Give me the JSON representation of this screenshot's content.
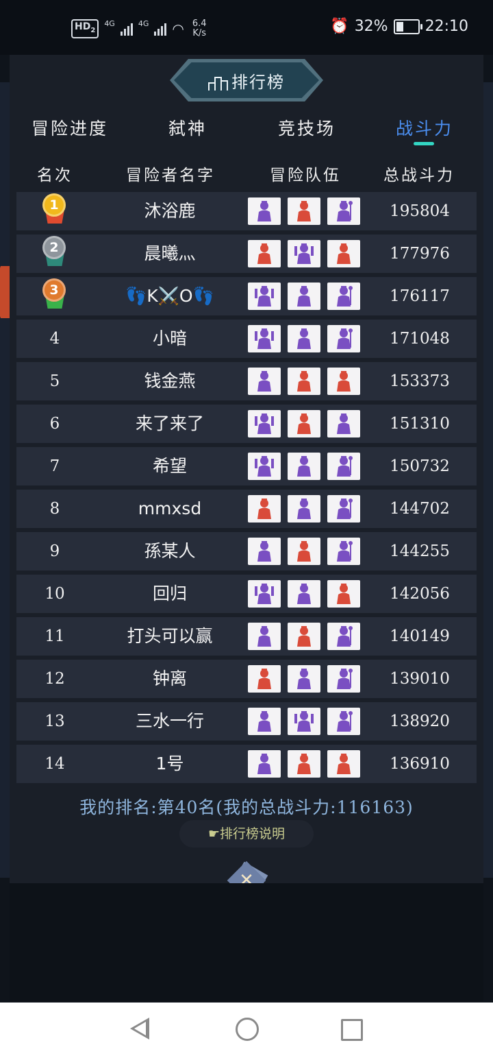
{
  "status_bar": {
    "hd_label": "HD",
    "hd_sub": "2",
    "network_1": "4G",
    "network_2": "4G",
    "speed_value": "6.4",
    "speed_unit": "K/s",
    "battery_text": "32%",
    "time": "22:10"
  },
  "title": "排行榜",
  "tabs": [
    {
      "label": "冒险进度",
      "active": false
    },
    {
      "label": "弑神",
      "active": false
    },
    {
      "label": "竞技场",
      "active": false
    },
    {
      "label": "战斗力",
      "active": true
    }
  ],
  "columns": {
    "rank": "名次",
    "name": "冒险者名字",
    "team": "冒险队伍",
    "power": "总战斗力"
  },
  "rows": [
    {
      "rank": "1",
      "name": "沐浴鹿",
      "power": "195804",
      "team": [
        "purple-hero-icon",
        "red-hero-icon",
        "purple-wizard-icon"
      ]
    },
    {
      "rank": "2",
      "name": "晨曦灬",
      "power": "177976",
      "team": [
        "red-hero-icon",
        "purple-warrior-icon",
        "red-hero-icon"
      ]
    },
    {
      "rank": "3",
      "name": "👣K⚔️O👣",
      "power": "176117",
      "team": [
        "purple-warrior-icon",
        "purple-hero-icon",
        "purple-wizard-icon"
      ]
    },
    {
      "rank": "4",
      "name": "小暗",
      "power": "171048",
      "team": [
        "purple-warrior-icon",
        "purple-hero-icon",
        "purple-wizard-icon"
      ]
    },
    {
      "rank": "5",
      "name": "钱金燕",
      "power": "153373",
      "team": [
        "purple-hero-icon",
        "red-hero-icon",
        "red-hero-icon"
      ]
    },
    {
      "rank": "6",
      "name": "来了来了",
      "power": "151310",
      "team": [
        "purple-warrior-icon",
        "red-hero-icon",
        "purple-hero-icon"
      ]
    },
    {
      "rank": "7",
      "name": "希望",
      "power": "150732",
      "team": [
        "purple-warrior-icon",
        "purple-hero-icon",
        "purple-wizard-icon"
      ]
    },
    {
      "rank": "8",
      "name": "mmxsd",
      "power": "144702",
      "team": [
        "red-hero-icon",
        "purple-hero-icon",
        "purple-wizard-icon"
      ]
    },
    {
      "rank": "9",
      "name": "孫某人",
      "power": "144255",
      "team": [
        "purple-hero-icon",
        "red-hero-icon",
        "purple-wizard-icon"
      ]
    },
    {
      "rank": "10",
      "name": "回归",
      "power": "142056",
      "team": [
        "purple-warrior-icon",
        "purple-hero-icon",
        "red-hero-icon"
      ]
    },
    {
      "rank": "11",
      "name": "打头可以赢",
      "power": "140149",
      "team": [
        "purple-hero-icon",
        "red-hero-icon",
        "purple-wizard-icon"
      ]
    },
    {
      "rank": "12",
      "name": "钟离",
      "power": "139010",
      "team": [
        "red-hero-icon",
        "purple-hero-icon",
        "purple-wizard-icon"
      ]
    },
    {
      "rank": "13",
      "name": "三水一行",
      "power": "138920",
      "team": [
        "purple-hero-icon",
        "purple-warrior-icon",
        "purple-wizard-icon"
      ]
    },
    {
      "rank": "14",
      "name": "1号",
      "power": "136910",
      "team": [
        "purple-hero-icon",
        "red-hero-icon",
        "red-hero-icon"
      ]
    }
  ],
  "my_rank": "我的排名:第40名(我的总战斗力:116163)",
  "explain_button": "☛排行榜说明",
  "close_symbol": "✕",
  "colors": {
    "purple": "#7a4fc2",
    "red": "#d94b3a",
    "active_tab": "#4b8ef0",
    "underline": "#33d6c3",
    "gold": "#f1b81c",
    "silver": "#8e959c",
    "bronze": "#e07a2e"
  }
}
